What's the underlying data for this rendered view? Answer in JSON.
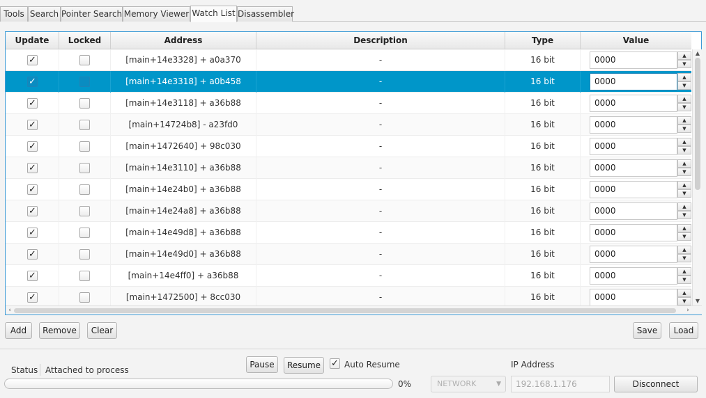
{
  "tabs": [
    {
      "label": "Tools"
    },
    {
      "label": "Search"
    },
    {
      "label": "Pointer Search"
    },
    {
      "label": "Memory Viewer"
    },
    {
      "label": "Watch List",
      "active": true
    },
    {
      "label": "Disassembler"
    }
  ],
  "table": {
    "columns": [
      "Update",
      "Locked",
      "Address",
      "Description",
      "Type",
      "Value"
    ],
    "selected_row": 1,
    "rows": [
      {
        "update": true,
        "locked": false,
        "address": "[main+14e3328] + a0a370",
        "description": "-",
        "type": "16 bit",
        "value": "0000"
      },
      {
        "update": true,
        "locked": false,
        "address": "[main+14e3318] + a0b458",
        "description": "-",
        "type": "16 bit",
        "value": "0000"
      },
      {
        "update": true,
        "locked": false,
        "address": "[main+14e3118] + a36b88",
        "description": "-",
        "type": "16 bit",
        "value": "0000"
      },
      {
        "update": true,
        "locked": false,
        "address": "[main+14724b8]  - a23fd0",
        "description": "-",
        "type": "16 bit",
        "value": "0000"
      },
      {
        "update": true,
        "locked": false,
        "address": "[main+1472640] + 98c030",
        "description": "-",
        "type": "16 bit",
        "value": "0000"
      },
      {
        "update": true,
        "locked": false,
        "address": "[main+14e3110] + a36b88",
        "description": "-",
        "type": "16 bit",
        "value": "0000"
      },
      {
        "update": true,
        "locked": false,
        "address": "[main+14e24b0] + a36b88",
        "description": "-",
        "type": "16 bit",
        "value": "0000"
      },
      {
        "update": true,
        "locked": false,
        "address": "[main+14e24a8] + a36b88",
        "description": "-",
        "type": "16 bit",
        "value": "0000"
      },
      {
        "update": true,
        "locked": false,
        "address": "[main+14e49d8] + a36b88",
        "description": "-",
        "type": "16 bit",
        "value": "0000"
      },
      {
        "update": true,
        "locked": false,
        "address": "[main+14e49d0] + a36b88",
        "description": "-",
        "type": "16 bit",
        "value": "0000"
      },
      {
        "update": true,
        "locked": false,
        "address": "[main+14e4ff0] + a36b88",
        "description": "-",
        "type": "16 bit",
        "value": "0000"
      },
      {
        "update": true,
        "locked": false,
        "address": "[main+1472500] + 8cc030",
        "description": "-",
        "type": "16 bit",
        "value": "0000"
      }
    ]
  },
  "actions": {
    "add": "Add",
    "remove": "Remove",
    "clear": "Clear",
    "save": "Save",
    "load": "Load"
  },
  "status": {
    "label": "Status",
    "text": "Attached to process",
    "progress_percent": 0,
    "progress_text": "0%"
  },
  "process_controls": {
    "pause": "Pause",
    "resume": "Resume",
    "auto_resume_label": "Auto Resume",
    "auto_resume_checked": true
  },
  "connection": {
    "mode": "NETWORK",
    "ip_label": "IP Address",
    "ip_value": "192.168.1.176",
    "disconnect": "Disconnect"
  },
  "icons": {
    "check": "check-icon",
    "spin_up": "triangle-up-icon",
    "spin_down": "triangle-down-icon",
    "dropdown": "chevron-down-icon"
  },
  "colors": {
    "selection": "#0096c9",
    "table_border": "#3c9ad6"
  }
}
